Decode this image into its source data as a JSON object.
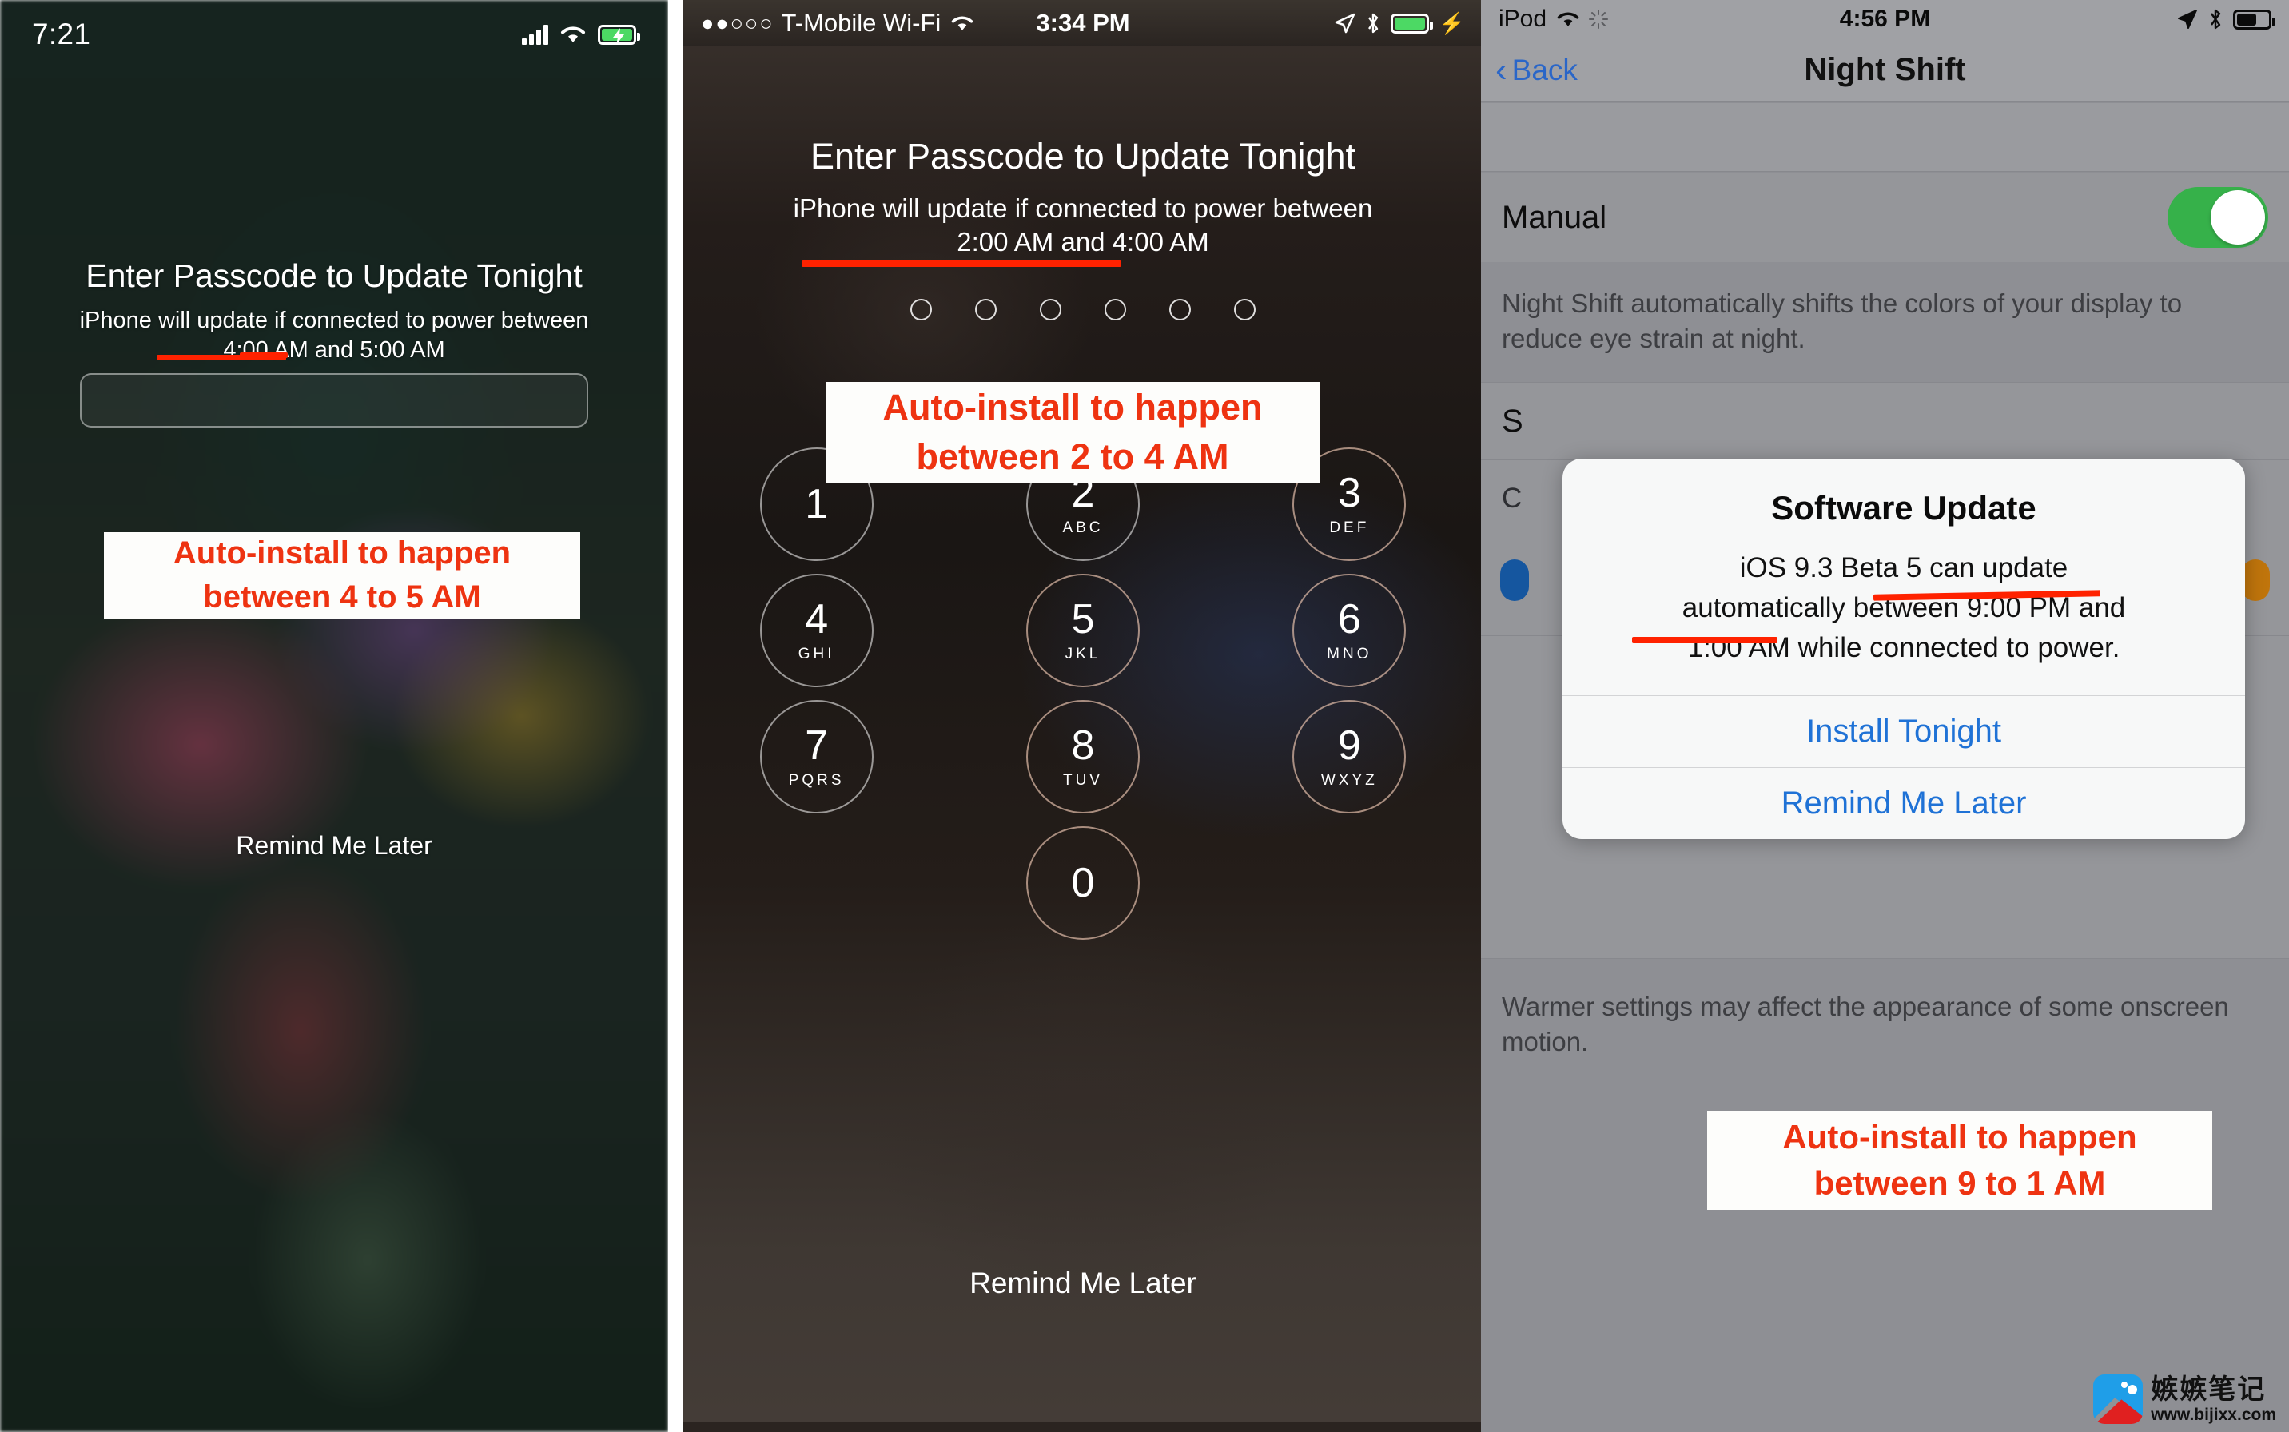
{
  "panel1": {
    "status": {
      "time": "7:21",
      "signal_icon": "signal-bars-icon",
      "wifi_icon": "wifi-icon",
      "battery_icon": "battery-charging-icon"
    },
    "title": "Enter Passcode to Update Tonight",
    "subtitle_line1": "iPhone will update if connected to power between",
    "subtitle_line2": "4:00 AM and 5:00 AM",
    "passcode_placeholder": "",
    "passcode_value": "",
    "remind_label": "Remind Me Later",
    "annotation_line1": "Auto-install to happen",
    "annotation_line2": "between 4 to 5 AM"
  },
  "panel2": {
    "status": {
      "signal_dots": "●●○○○",
      "carrier": "T-Mobile Wi-Fi",
      "wifi_icon": "wifi-icon",
      "time": "3:34 PM",
      "location_icon": "location-arrow-icon",
      "bluetooth_icon": "bluetooth-icon",
      "battery_icon": "battery-icon",
      "charging_icon": "lightning-bolt-icon"
    },
    "title": "Enter Passcode to Update Tonight",
    "subtitle_line1": "iPhone will update if connected to power between",
    "subtitle_line2": "2:00 AM and 4:00 AM",
    "passcode_dots": 6,
    "keys": [
      {
        "num": "1",
        "alpha": ""
      },
      {
        "num": "2",
        "alpha": "ABC"
      },
      {
        "num": "3",
        "alpha": "DEF"
      },
      {
        "num": "4",
        "alpha": "GHI"
      },
      {
        "num": "5",
        "alpha": "JKL"
      },
      {
        "num": "6",
        "alpha": "MNO"
      },
      {
        "num": "7",
        "alpha": "PQRS"
      },
      {
        "num": "8",
        "alpha": "TUV"
      },
      {
        "num": "9",
        "alpha": "WXYZ"
      },
      {
        "num": "0",
        "alpha": ""
      }
    ],
    "remind_label": "Remind Me Later",
    "annotation_line1": "Auto-install to happen",
    "annotation_line2": "between 2 to 4 AM"
  },
  "panel3": {
    "status": {
      "device": "iPod",
      "wifi_icon": "wifi-icon",
      "sync_icon": "activity-spinner-icon",
      "time": "4:56 PM",
      "location_icon": "location-arrow-icon",
      "bluetooth_icon": "bluetooth-icon",
      "battery_icon": "battery-icon"
    },
    "back_label": "Back",
    "nav_title": "Night Shift",
    "manual_label": "Manual",
    "manual_toggle_on": true,
    "note1": "Night Shift automatically shifts the colors of your display to reduce eye strain at night.",
    "row_s_label": "S",
    "row_c_label": "C",
    "note2": "Warmer settings may affect the appearance of some onscreen motion.",
    "alert": {
      "title": "Software Update",
      "message_line1": "iOS 9.3 Beta 5 can update",
      "message_line2": "automatically between 9:00 PM and",
      "message_line3": "1:00 AM while connected to power.",
      "install_label": "Install Tonight",
      "remind_label": "Remind Me Later"
    },
    "annotation_line1": "Auto-install to happen",
    "annotation_line2": "between 9 to 1 AM"
  },
  "watermark": {
    "cn": "嫉嫉笔记",
    "url": "www.bijixx.com"
  },
  "colors": {
    "annotation_red": "#ee3311",
    "underline_red": "#ff2200",
    "ios_blue": "#1f72d6",
    "toggle_green": "#36b14a"
  }
}
